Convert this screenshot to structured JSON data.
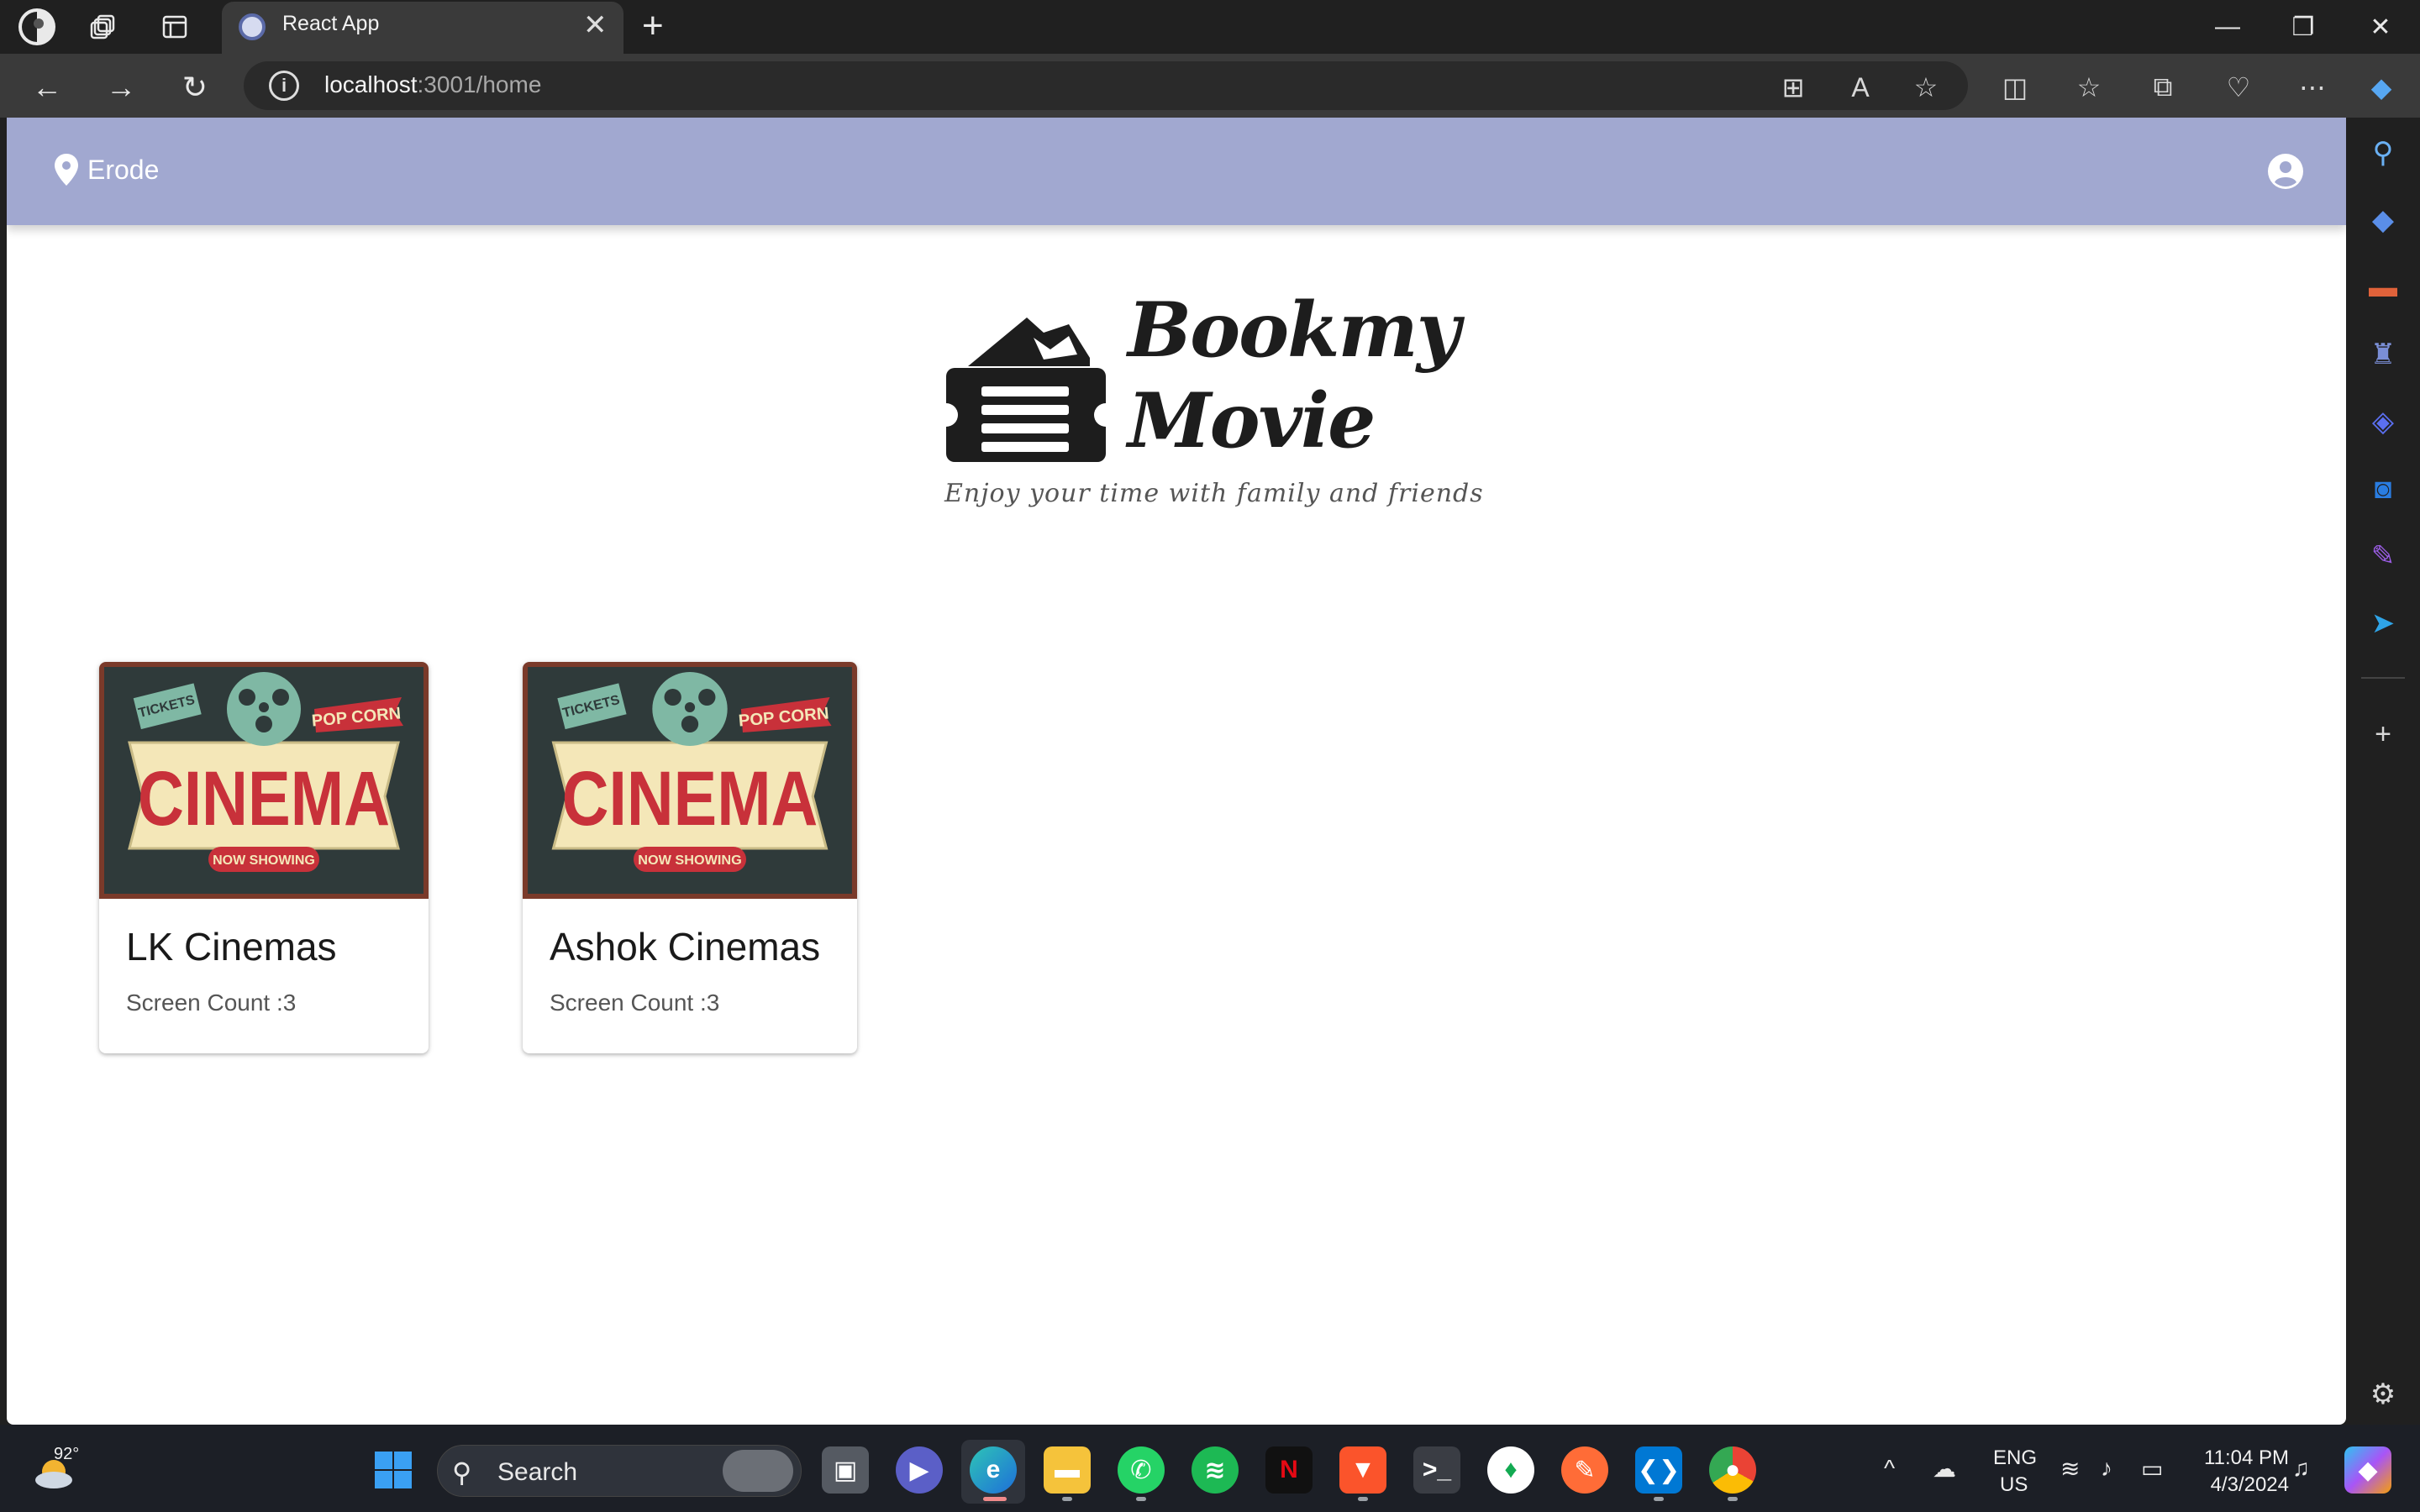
{
  "browser": {
    "tab_title": "React App",
    "url_host": "localhost",
    "url_rest": ":3001/home"
  },
  "app": {
    "location": "Erode",
    "logo": {
      "title_line1": "Bookmy",
      "title_line2": "Movie",
      "tagline": "Enjoy your time with family and friends"
    },
    "theaters": [
      {
        "name": "LK Cinemas",
        "screen_count": "Screen Count :3"
      },
      {
        "name": "Ashok Cinemas",
        "screen_count": "Screen Count :3"
      }
    ],
    "poster": {
      "main": "CINEMA",
      "tickets": "TICKETS",
      "popcorn": "POP CORN",
      "showing": "NOW SHOWING"
    },
    "colors": {
      "appbar": "#a1a8d0"
    }
  },
  "taskbar": {
    "weather_temp": "92°",
    "search_placeholder": "Search",
    "lang_line1": "ENG",
    "lang_line2": "US",
    "time": "11:04 PM",
    "date": "4/3/2024",
    "apps": [
      "file-explorer",
      "edge",
      "files",
      "whatsapp",
      "spotify",
      "netflix",
      "brave",
      "terminal",
      "mongodb",
      "postman",
      "vscode",
      "chrome"
    ]
  }
}
